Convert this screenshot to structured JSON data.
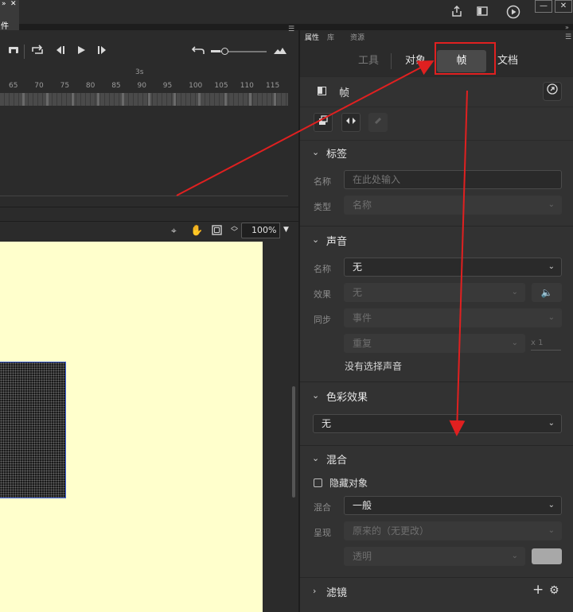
{
  "window": {
    "doc_tab_label": "件",
    "minimize_label": "—",
    "close_label": "✕"
  },
  "timeline": {
    "time_marker": "3s",
    "frame_ticks": [
      "65",
      "70",
      "75",
      "80",
      "85",
      "90",
      "95",
      "100",
      "105",
      "110",
      "115"
    ]
  },
  "stage": {
    "zoom": "100%",
    "canvas_color": "#ffffcc",
    "selection_color": "#3c5fd8"
  },
  "panel": {
    "tabs": [
      "属性",
      "库",
      "资源"
    ],
    "sub_tabs": [
      "工具",
      "对象",
      "帧",
      "文档"
    ],
    "selected_sub_tab": "帧",
    "frame_header_label": "帧",
    "sections": {
      "label": {
        "title": "标签",
        "name_label": "名称",
        "name_placeholder": "在此处输入",
        "type_label": "类型",
        "type_value": "名称"
      },
      "sound": {
        "title": "声音",
        "name_label": "名称",
        "name_value": "无",
        "effect_label": "效果",
        "effect_value": "无",
        "sync_label": "同步",
        "sync_value": "事件",
        "repeat_value": "重复",
        "repeat_count": "x 1",
        "no_sound_text": "没有选择声音"
      },
      "color_effect": {
        "title": "色彩效果",
        "value": "无"
      },
      "blend": {
        "title": "混合",
        "hide_object_label": "隐藏对象",
        "blend_label": "混合",
        "blend_value": "一般",
        "render_label": "呈现",
        "render_value": "原来的（无更改）",
        "transparent_value": "透明",
        "swatch_color": "#a8a8a8"
      },
      "filters": {
        "title": "滤镜",
        "add_label": "+"
      }
    }
  },
  "annotation_color": "#e02020"
}
